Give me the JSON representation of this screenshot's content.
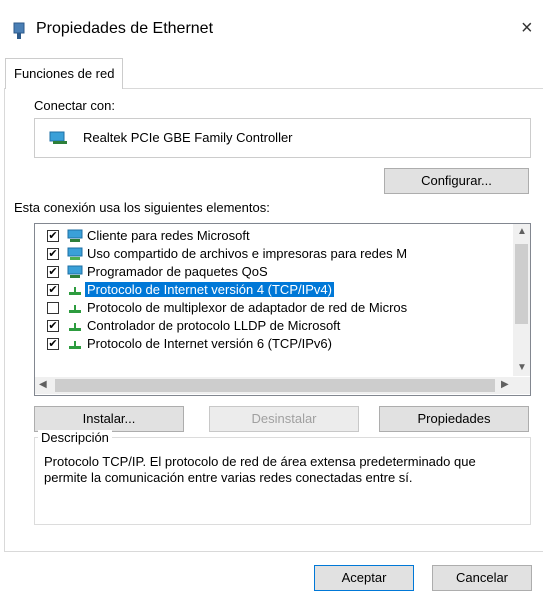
{
  "dialog": {
    "title": "Propiedades de Ethernet",
    "close_glyph": "×"
  },
  "tabs": [
    {
      "label": "Funciones de red"
    }
  ],
  "connect": {
    "label": "Conectar con:",
    "adapter_name": "Realtek PCIe GBE Family Controller",
    "adapter_icon": "network-adapter-icon",
    "configure_button": "Configurar..."
  },
  "items_section": {
    "label": "Esta conexión usa los siguientes elementos:",
    "items": [
      {
        "label": "Cliente para redes Microsoft",
        "checked": true,
        "icon": "network-client-icon"
      },
      {
        "label": "Uso compartido de archivos e impresoras para redes M",
        "checked": true,
        "icon": "file-sharing-icon"
      },
      {
        "label": "Programador de paquetes QoS",
        "checked": true,
        "icon": "qos-scheduler-icon"
      },
      {
        "label": "Protocolo de Internet versión 4 (TCP/IPv4)",
        "checked": true,
        "icon": "protocol-icon",
        "selected": true
      },
      {
        "label": "Protocolo de multiplexor de adaptador de red de Micros",
        "checked": false,
        "icon": "protocol-icon"
      },
      {
        "label": "Controlador de protocolo LLDP de Microsoft",
        "checked": true,
        "icon": "protocol-icon"
      },
      {
        "label": "Protocolo de Internet versión 6 (TCP/IPv6)",
        "checked": true,
        "icon": "protocol-icon"
      }
    ],
    "checkmark_glyph": "✔"
  },
  "actions": {
    "install": "Instalar...",
    "uninstall": "Desinstalar",
    "properties": "Propiedades"
  },
  "description": {
    "legend": "Descripción",
    "text": "Protocolo TCP/IP. El protocolo de red de área extensa predeterminado que permite la comunicación entre varias redes conectadas entre sí."
  },
  "footer": {
    "ok": "Aceptar",
    "cancel": "Cancelar"
  },
  "colors": {
    "selection": "#0078d7",
    "button_face": "#e1e1e1"
  }
}
